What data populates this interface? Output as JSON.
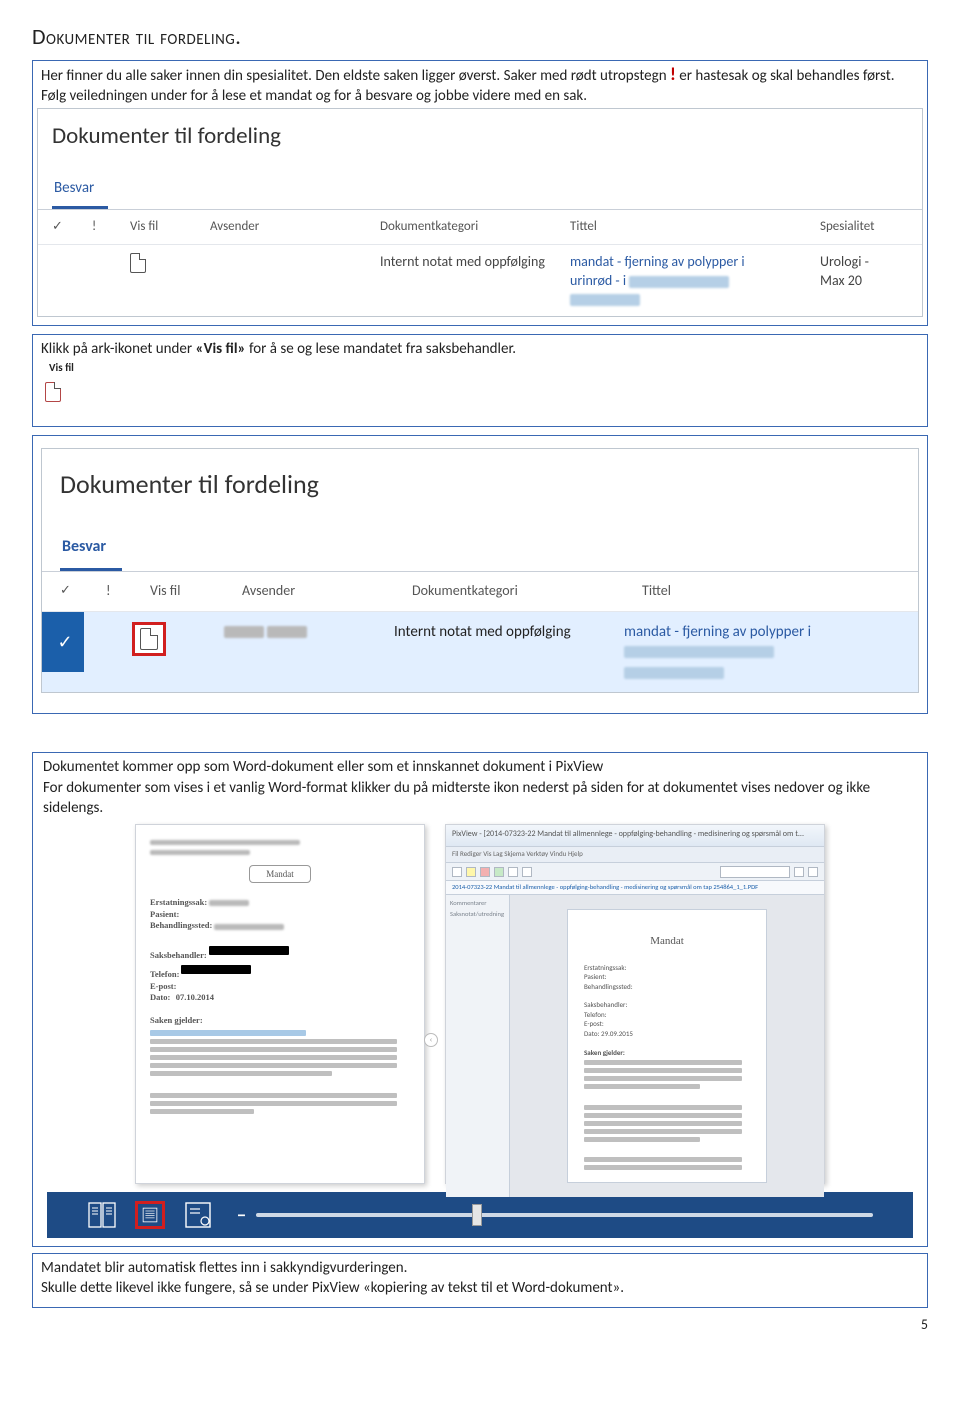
{
  "heading": "Dokumenter til fordeling.",
  "intro": {
    "line1a": "Her finner du alle saker innen din spesialitet. Den eldste saken ligger øverst. Saker med rødt utropstegn ",
    "line1b": " er hastesak og skal behandles først.",
    "line2": "Følg veiledningen under for å lese et mandat og for å besvare og jobbe videre med en sak."
  },
  "shot1": {
    "title": "Dokumenter til fordeling",
    "tab": "Besvar",
    "cols": {
      "c1": "✓",
      "c2": "!",
      "visfil": "Vis fil",
      "avsender": "Avsender",
      "kategori": "Dokumentkategori",
      "tittel": "Tittel",
      "spes": "Spesialitet"
    },
    "row": {
      "kategori": "Internt notat med oppfølging",
      "tittel_a": "mandat - fjerning av polypper i",
      "tittel_b": "urinrød - i",
      "spes_a": "Urologi -",
      "spes_b": "Max 20"
    }
  },
  "caption1": {
    "a": "Klikk på ark-ikonet under ",
    "b": "«Vis fil»",
    "c": " for å se og lese mandatet fra saksbehandler."
  },
  "visfil_label": "Vis fil",
  "shot2": {
    "title": "Dokumenter til fordeling",
    "tab": "Besvar",
    "cols": {
      "c1": "✓",
      "c2": "!",
      "visfil": "Vis fil",
      "avsender": "Avsender",
      "kategori": "Dokumentkategori",
      "tittel": "Tittel"
    },
    "row": {
      "check": "✓",
      "kategori": "Internt notat med oppfølging",
      "tittel": "mandat - fjerning av polypper i"
    }
  },
  "para3a": "Dokumentet kommer opp som Word-dokument eller som et innskannet dokument i PixView",
  "para3b": "For dokumenter som vises i et vanlig Word-format klikker du på midterste ikon nederst på siden for  at dokumentet vises nedover og ikke sidelengs.",
  "wordthumb": {
    "top_line": "",
    "title_button": "Mandat",
    "fields": {
      "f1": "Erstatningssak:",
      "f2": "Pasient:",
      "f3": "Behandlingssted:",
      "f4": "Saksbehandler:",
      "f5": "Telefon:",
      "f6": "E-post:",
      "f7": "Dato:",
      "dato": "07.10.2014",
      "f8": "Saken gjelder:"
    }
  },
  "viewer": {
    "title_prefix": "PixView - [",
    "title_body": "2014-07323-22 Mandat til allmennlege - oppfølging-behandling - medisinering og spørsmål om t... ",
    "menu": "Fil  Rediger  Vis  Lag  Skjema  Verktøy  Vindu  Hjelp",
    "tabtext": "2014-07323-22 Mandat til allmennlege - oppfølging-behandling - medisinering og spørsmål om tap 254864_1_1.PDF",
    "side1": "Kommentarer",
    "side2": "Saksnotat/utredning",
    "page": {
      "title": "Mandat",
      "f1": "Erstatningssak:",
      "f2": "Pasient:",
      "f3": "Behandlingssted:",
      "f4": "Saksbehandler:",
      "f5": "Telefon:",
      "f6": "E-post:",
      "f7": "Dato:    29.09.2015",
      "f8": "Saken gjelder:"
    }
  },
  "caption_bottom1": "Mandatet blir automatisk flettes inn i sakkyndigvurderingen.",
  "caption_bottom2": "Skulle dette likevel ikke fungere, så se under PixView  «kopiering av tekst til et Word-dokument».",
  "pagenum": "5"
}
